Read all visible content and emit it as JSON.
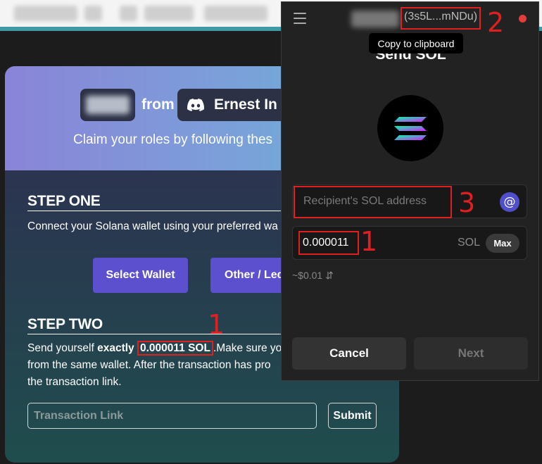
{
  "claim_card": {
    "from_label": "from",
    "server_name": "Ernest In D",
    "claim_text": "Claim your roles by following thes",
    "step_one": {
      "title": "STEP ONE",
      "desc": "Connect your Solana wallet using your preferred wa",
      "select_wallet": "Select Wallet",
      "other_ledger": "Other / Led"
    },
    "step_two": {
      "title": "STEP TWO",
      "line1_prefix": "Send yourself ",
      "line1_exactly": "exactly",
      "line1_amount": "0.000011 SOL",
      "line1_suffix": ".Make sure yo",
      "line2": "from the same wallet. After the transaction has pro",
      "line3": "the transaction link.",
      "tx_placeholder": "Transaction Link",
      "submit": "Submit"
    }
  },
  "popup": {
    "account_address": "(3s5L...mNDu)",
    "tooltip": "Copy to clipboard",
    "title": "Send SOL",
    "recipient_placeholder": "Recipient's SOL address",
    "at_symbol": "@",
    "amount": "0.000011",
    "unit": "SOL",
    "max": "Max",
    "usd_value": "~$0.01",
    "swap_icon": "⇵",
    "cancel": "Cancel",
    "next": "Next"
  },
  "annotations": {
    "left_marker": "1",
    "amount_marker": "1",
    "address_marker": "2",
    "recipient_marker": "3"
  },
  "colors": {
    "accent_purple": "#5d50cf",
    "annotation_red": "#e02020",
    "status_dot": "#e43b3b"
  }
}
